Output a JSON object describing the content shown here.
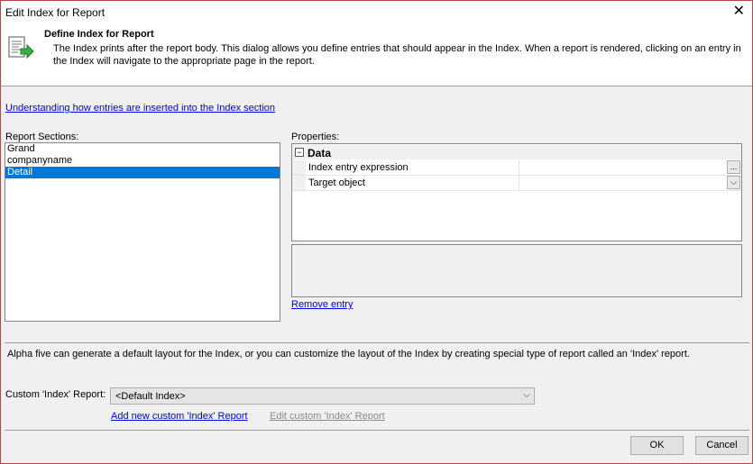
{
  "window": {
    "title": "Edit Index for Report",
    "close_glyph": "✕"
  },
  "header": {
    "title": "Define Index for Report",
    "description_line1": "The Index prints after the report body.  This dialog allows you define entries that should appear in the Index. When a report is rendered, clicking on an entry in",
    "description_line2": "the Index will navigate to the appropriate page in the report.",
    "icon": "report-index-icon"
  },
  "help_link": "Understanding how entries are inserted into the Index section",
  "sections": {
    "label": "Report Sections:",
    "items": [
      "Grand",
      "companyname",
      "Detail"
    ],
    "selected": "Detail"
  },
  "properties": {
    "label": "Properties:",
    "category": "Data",
    "category_toggle": "−",
    "rows": [
      {
        "name": "Index entry expression",
        "button": "..."
      },
      {
        "name": "Target object",
        "button": "⌵"
      }
    ]
  },
  "remove_entry": "Remove entry",
  "info_text": "Alpha five can generate a default layout for the Index, or you can customize the layout of the Index by creating special type of report called an 'Index' report.",
  "custom_report": {
    "label": "Custom 'Index' Report:",
    "value": "<Default Index>",
    "add_link": "Add new custom 'Index' Report",
    "edit_link": "Edit custom 'Index' Report"
  },
  "buttons": {
    "ok": "OK",
    "cancel": "Cancel"
  },
  "colors": {
    "selection": "#0078d7",
    "link": "#0000ee",
    "disabled_link": "#8a8a8a",
    "border": "#b04a4a"
  }
}
